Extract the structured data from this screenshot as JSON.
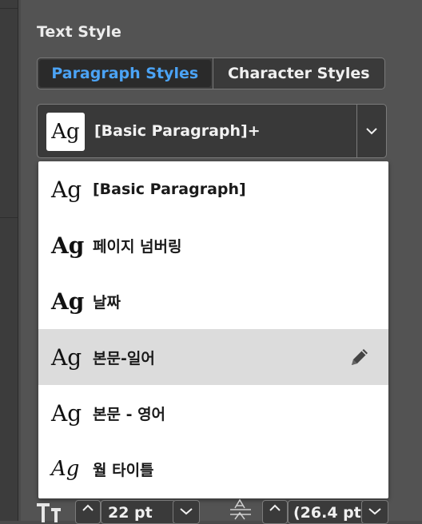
{
  "panel": {
    "title": "Text Style",
    "tabs": [
      {
        "label": "Paragraph Styles",
        "active": true
      },
      {
        "label": "Character Styles",
        "active": false
      }
    ],
    "accent_color": "#4ba3f5"
  },
  "selector": {
    "preview": "Ag",
    "value": "[Basic Paragraph]+",
    "arrow_icon": "chevron-down-icon"
  },
  "menu": {
    "items": [
      {
        "glyph": "Ag",
        "label": "[Basic Paragraph]",
        "highlighted": false
      },
      {
        "glyph": "Ag",
        "label": "페이지 넘버링",
        "highlighted": false
      },
      {
        "glyph": "Ag",
        "label": "날짜",
        "highlighted": false
      },
      {
        "glyph": "Ag",
        "label": "본문-일어",
        "highlighted": true,
        "trailing_icon": "pencil-icon"
      },
      {
        "glyph": "Ag",
        "label": "본문 - 영어",
        "highlighted": false
      },
      {
        "glyph": "Ag",
        "label": "월 타이틀",
        "highlighted": false
      }
    ]
  },
  "bottom": {
    "font_size": "22 pt",
    "leading": "(26.4 pt"
  }
}
